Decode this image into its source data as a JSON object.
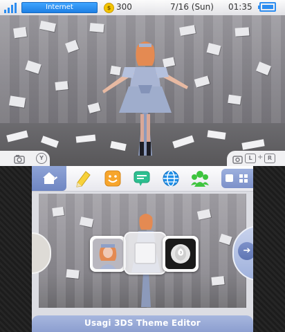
{
  "status_bar": {
    "connection_label": "Internet",
    "coins": "300",
    "coin_symbol": "$",
    "date": "7/16 (Sun)",
    "time": "01:35"
  },
  "top_tabs": {
    "left_icons": [
      "camera-icon",
      "y-button-icon"
    ],
    "y_glyph": "Y",
    "right_icons": [
      "camera-icon",
      "l-button-icon",
      "r-button-icon"
    ],
    "l_glyph": "L",
    "plus_glyph": "+",
    "r_glyph": "R"
  },
  "toolbar": {
    "items": [
      "home-settings-icon",
      "pencil-icon",
      "smiley-icon",
      "speech-bubble-icon",
      "globe-icon",
      "friends-icon"
    ],
    "right": [
      "square-view-icon",
      "grid-view-icon"
    ]
  },
  "home_menu": {
    "app_icons": [
      "portrait-photo-icon",
      "empty-slot",
      "rose-photo-icon"
    ],
    "scroll_arrow_glyph": "➔"
  },
  "bottom_bar": {
    "title": "Usagi   3DS Theme Editor"
  },
  "colors": {
    "accent_blue": "#2d8df0",
    "toolbar_home": "#7e93cc",
    "bottom_bar": "#98aad6"
  }
}
